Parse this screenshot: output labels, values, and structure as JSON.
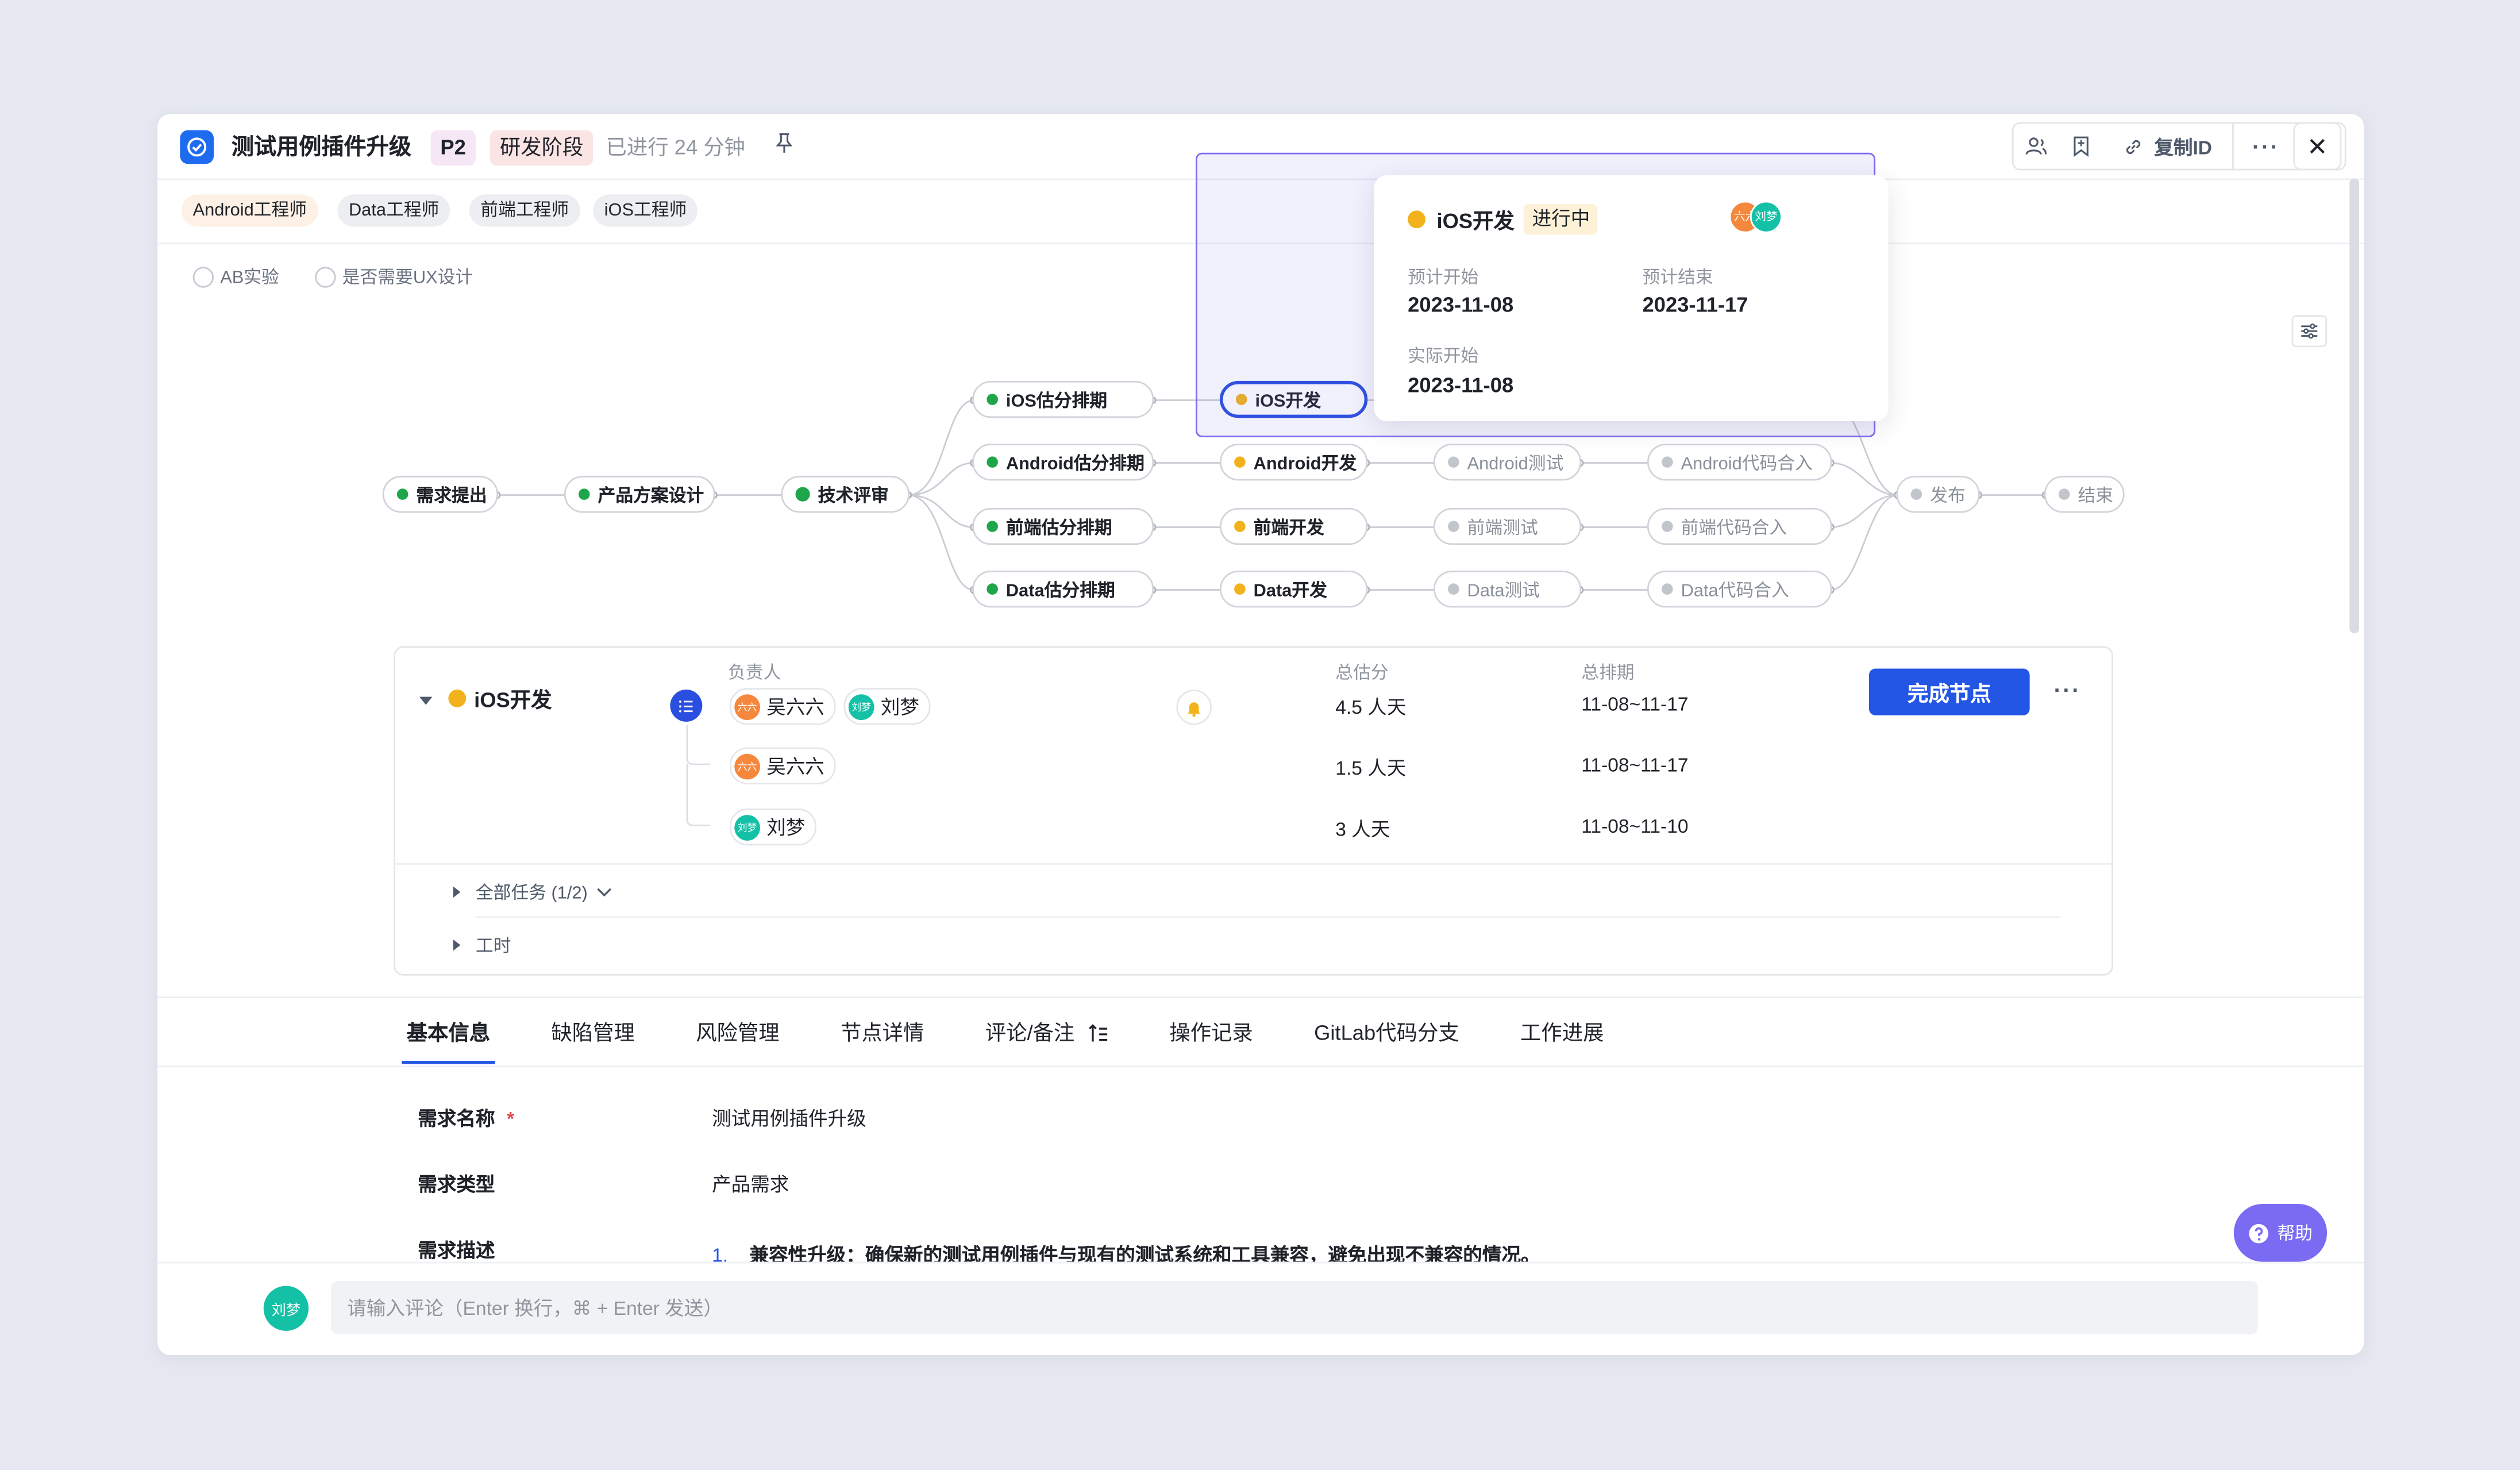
{
  "header": {
    "title": "测试用例插件升级",
    "priority": "P2",
    "stage": "研发阶段",
    "elapsed": "已进行 24 分钟",
    "copy_id_label": "复制ID"
  },
  "roles": [
    "Android工程师",
    "Data工程师",
    "前端工程师",
    "iOS工程师"
  ],
  "options": [
    "AB实验",
    "是否需要UX设计"
  ],
  "flow": {
    "nodes": {
      "req": "需求提出",
      "design": "产品方案设计",
      "review": "技术评审",
      "ios_est": "iOS估分排期",
      "android_est": "Android估分排期",
      "fe_est": "前端估分排期",
      "data_est": "Data估分排期",
      "ios_dev": "iOS开发",
      "android_dev": "Android开发",
      "fe_dev": "前端开发",
      "data_dev": "Data开发",
      "android_test": "Android测试",
      "fe_test": "前端测试",
      "data_test": "Data测试",
      "android_merge": "Android代码合入",
      "fe_merge": "前端代码合入",
      "data_merge": "Data代码合入",
      "release": "发布",
      "end": "结束"
    }
  },
  "tooltip": {
    "title": "iOS开发",
    "status": "进行中",
    "avatars": [
      "六六",
      "刘梦"
    ],
    "planned_start_label": "预计开始",
    "planned_start": "2023-11-08",
    "planned_end_label": "预计结束",
    "planned_end": "2023-11-17",
    "actual_start_label": "实际开始",
    "actual_start": "2023-11-08"
  },
  "detail": {
    "node_name": "iOS开发",
    "owner_header": "负责人",
    "estimate_header": "总估分",
    "schedule_header": "总排期",
    "owners": [
      "吴六六",
      "刘梦"
    ],
    "owner_avatars": [
      "六六",
      "刘梦"
    ],
    "total_estimate": "4.5 人天",
    "total_schedule": "11-08~11-17",
    "rows": [
      {
        "owner": "吴六六",
        "avatar": "六六",
        "estimate": "1.5 人天",
        "schedule": "11-08~11-17"
      },
      {
        "owner": "刘梦",
        "avatar": "刘梦",
        "estimate": "3 人天",
        "schedule": "11-08~11-10"
      }
    ],
    "complete_button": "完成节点",
    "all_tasks": "全部任务 (1/2)",
    "worktime": "工时"
  },
  "tabs": [
    "基本信息",
    "缺陷管理",
    "风险管理",
    "节点详情",
    "评论/备注",
    "操作记录",
    "GitLab代码分支",
    "工作进展"
  ],
  "form": {
    "name_label": "需求名称",
    "required_mark": "*",
    "name_value": "测试用例插件升级",
    "type_label": "需求类型",
    "type_value": "产品需求",
    "desc_label": "需求描述",
    "desc_item_num": "1.",
    "desc_item": "兼容性升级：确保新的测试用例插件与现有的测试系统和工具兼容，避免出现不兼容的情况。"
  },
  "help_label": "帮助",
  "comment": {
    "avatar": "刘梦",
    "placeholder": "请输入评论（Enter 换行，⌘ + Enter 发送）"
  },
  "colors": {
    "accent": "#2456E5",
    "done": "#1FA64A",
    "in_progress": "#F2B21B",
    "todo": "#C2C6CC"
  }
}
